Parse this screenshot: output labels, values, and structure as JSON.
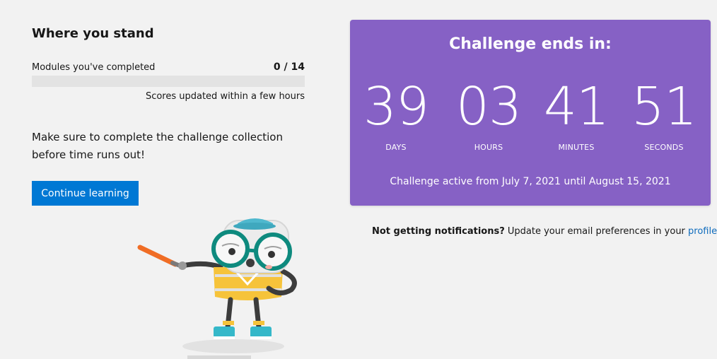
{
  "standing": {
    "title": "Where you stand",
    "modules_label": "Modules you've completed",
    "modules_count": "0 / 14",
    "progress_fraction": 0,
    "scores_note": "Scores updated within a few hours",
    "reminder": "Make sure to complete the challenge collection before time runs out!",
    "continue_label": "Continue learning"
  },
  "countdown": {
    "title": "Challenge ends in:",
    "days": "39",
    "days_label": "DAYS",
    "hours": "03",
    "hours_label": "HOURS",
    "minutes": "41",
    "minutes_label": "MINUTES",
    "seconds": "51",
    "seconds_label": "SECONDS",
    "active_range": "Challenge active from July 7, 2021 until August 15, 2021",
    "background_color": "#8661c5"
  },
  "notifications": {
    "question": "Not getting notifications?",
    "text": " Update your email preferences in your ",
    "link_label": "profile"
  },
  "colors": {
    "primary": "#0078d4",
    "link": "#0f6cbd",
    "page_background": "#f2f2f2"
  },
  "illustration": {
    "icon": "mascot-pointer-icon"
  }
}
